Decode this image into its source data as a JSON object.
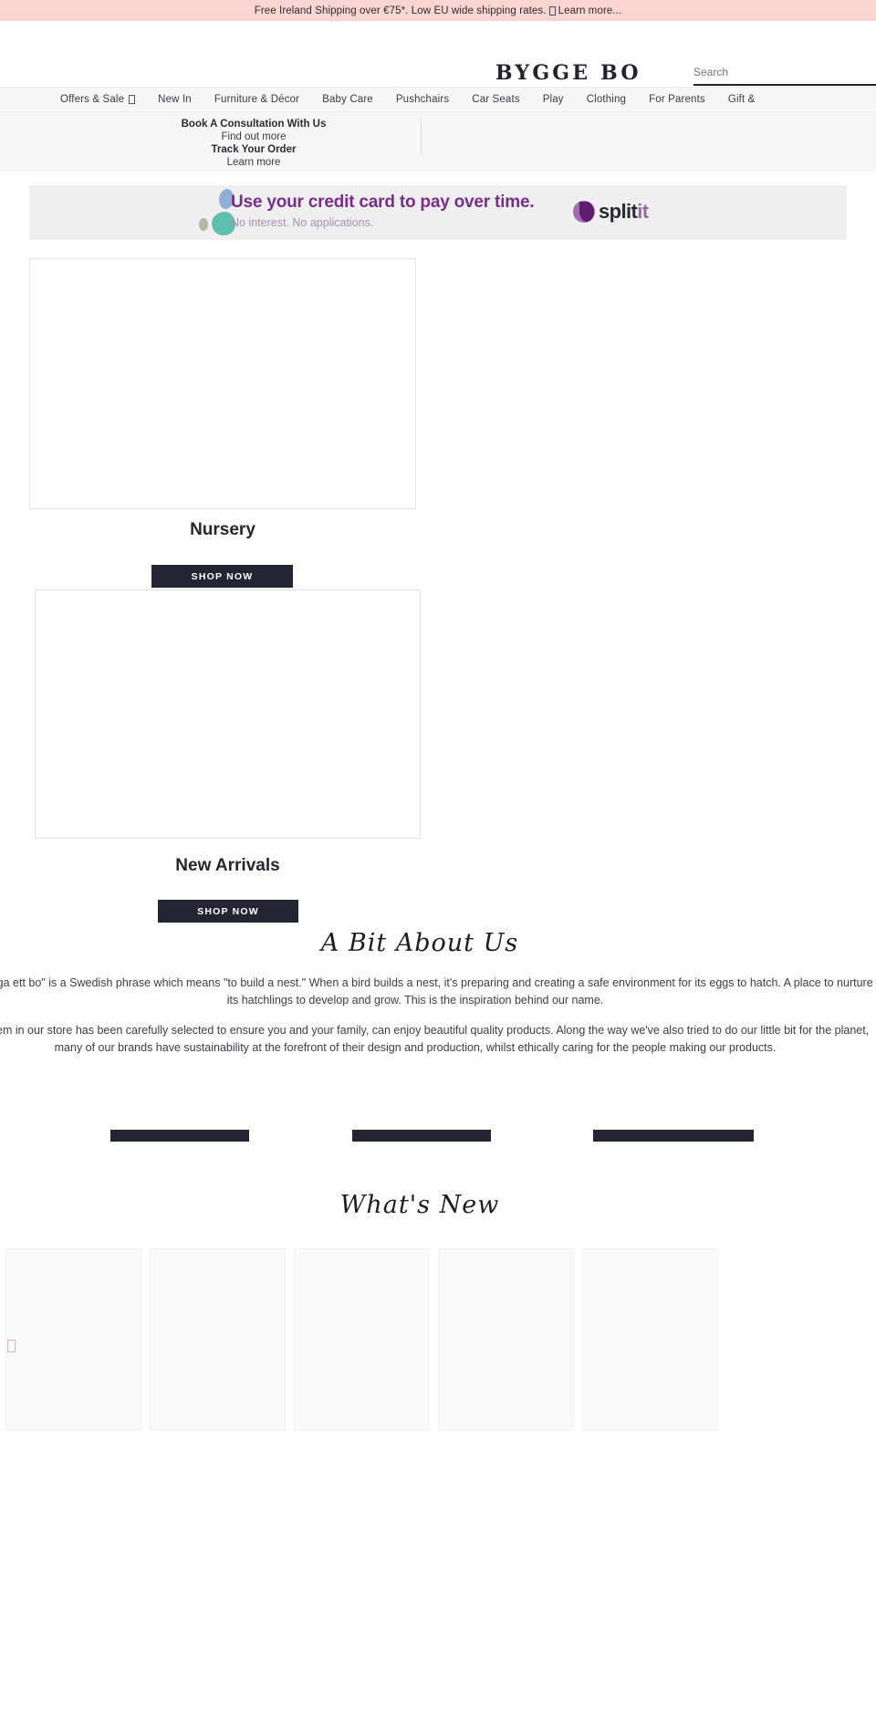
{
  "announcement": {
    "text_before": "Free Ireland Shipping over €75*. Low EU wide shipping rates.",
    "icon": "missing-glyph-box",
    "text_after": "Learn more..."
  },
  "header": {
    "logo": "BYGGE BO",
    "search_placeholder": "Search",
    "search_value": ""
  },
  "nav": {
    "items": [
      {
        "label": "Offers & Sale",
        "has_glyph": true
      },
      {
        "label": "New In",
        "has_glyph": false
      },
      {
        "label": "Furniture & Décor",
        "has_glyph": false
      },
      {
        "label": "Baby Care",
        "has_glyph": false
      },
      {
        "label": "Pushchairs",
        "has_glyph": false
      },
      {
        "label": "Car Seats",
        "has_glyph": false
      },
      {
        "label": "Play",
        "has_glyph": false
      },
      {
        "label": "Clothing",
        "has_glyph": false
      },
      {
        "label": "For Parents",
        "has_glyph": false
      },
      {
        "label": "Gift &",
        "has_glyph": false
      }
    ]
  },
  "subpromo": {
    "consultation_title": "Book A Consultation With Us",
    "consultation_link": "Find out more",
    "track_title": "Track Your Order",
    "track_link": "Learn more"
  },
  "splitit": {
    "headline": "Use your credit card to pay over time.",
    "subline": "No interest. No applications.",
    "brand_split": "split",
    "brand_it": "it"
  },
  "hero": {
    "tile1": {
      "title": "Nursery",
      "button": "SHOP NOW"
    },
    "tile2": {
      "title": "New Arrivals",
      "button": "SHOP NOW"
    }
  },
  "about": {
    "heading": "A Bit About Us",
    "paragraph1": "\"Att bygga ett bo\" is a Swedish phrase which means \"to build a nest.\" When a bird builds a nest, it's preparing and creating a safe environment for its eggs to hatch. A place to nurture its hatchlings to develop and grow. This is the inspiration behind our name.",
    "paragraph2": "Each item in our store has been carefully selected to ensure you and your family, can enjoy beautiful quality products.  Along the way we've also tried to do our little bit for the planet, many of our brands have sustainability at the forefront of their design and production, whilst ethically caring for the people making our products.",
    "buttons": [
      "",
      "",
      ""
    ]
  },
  "whats_new": {
    "heading": "What's New",
    "products": [
      "",
      "",
      "",
      "",
      ""
    ]
  },
  "colors": {
    "announce_bg": "#fbd5d2",
    "dark": "#242433",
    "nav_bg": "#f7f7f7",
    "splitit_bg": "#efefef",
    "splitit_purple": "#7a2e8c",
    "splitit_light": "#a98fb5"
  }
}
